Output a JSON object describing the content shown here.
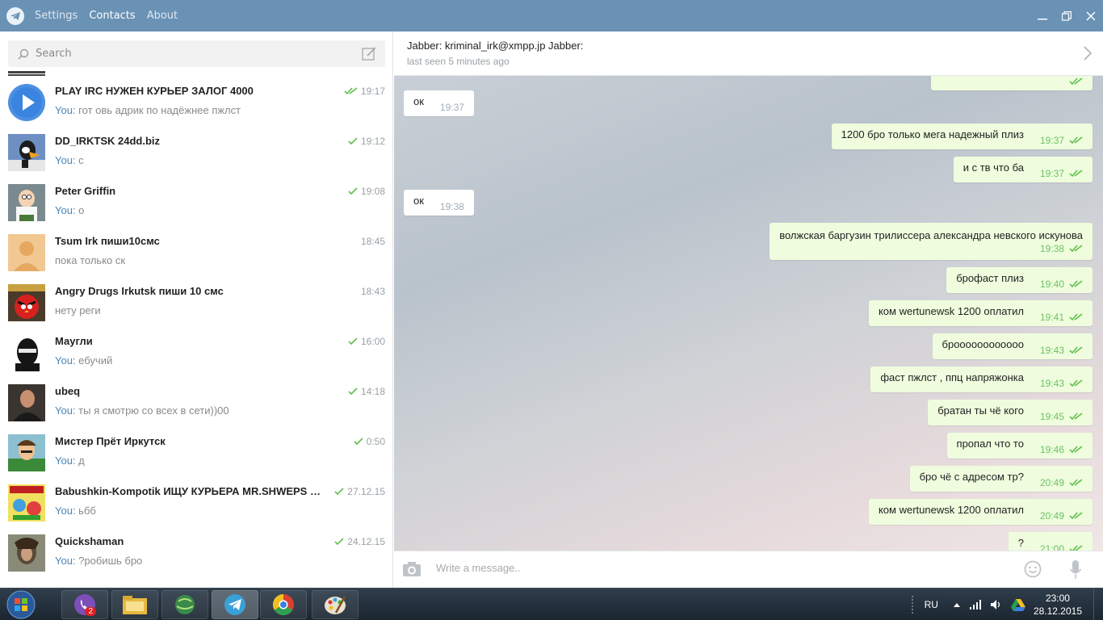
{
  "menu": {
    "settings": "Settings",
    "contacts": "Contacts",
    "about": "About"
  },
  "search": {
    "placeholder": "Search"
  },
  "chats": [
    {
      "name": "PLAY IRC НУЖЕН КУРЬЕР ЗАЛОГ 4000",
      "time": "19:17",
      "you": "You:",
      "preview": " гот овь адрик по надёжнее пжлст",
      "read": "double"
    },
    {
      "name": "DD_IRKTSK 24dd.biz",
      "time": "19:12",
      "you": "You:",
      "preview": " с",
      "read": "single"
    },
    {
      "name": "Peter Griffin",
      "time": "19:08",
      "you": "You:",
      "preview": " о",
      "read": "single"
    },
    {
      "name": "Tsum Irk пиши10смс",
      "time": "18:45",
      "you": "",
      "preview": "пока только ск",
      "read": "none"
    },
    {
      "name": "Angry Drugs Irkutsk пиши 10 смс",
      "time": "18:43",
      "you": "",
      "preview": "нету реги",
      "read": "none"
    },
    {
      "name": "Маугли",
      "time": "16:00",
      "you": "You:",
      "preview": " ебучий",
      "read": "single"
    },
    {
      "name": "ubeq",
      "time": "14:18",
      "you": "You:",
      "preview": " ты я смотрю со всех в сети))00",
      "read": "single"
    },
    {
      "name": "Мистер Прёт Иркутск",
      "time": "0:50",
      "you": "You:",
      "preview": " д",
      "read": "single"
    },
    {
      "name": "Babushkin-Kompotik ИЩУ КУРЬЕРА MR.SHWEPS @S...",
      "time": "27.12.15",
      "you": "You:",
      "preview": " ьбб",
      "read": "single"
    },
    {
      "name": "Quickshaman",
      "time": "24.12.15",
      "you": "You:",
      "preview": " ?робишь бро",
      "read": "single"
    }
  ],
  "header": {
    "title": "Jabber: kriminal_irk@xmpp.jp Jabber:",
    "status": "last seen 5 minutes ago"
  },
  "messages": [
    {
      "dir": "in",
      "text": "ок",
      "time": "19:37"
    },
    {
      "dir": "out",
      "text": "1200 бро только мега надежный плиз",
      "time": "19:37"
    },
    {
      "dir": "out",
      "text": "и с тв что ба",
      "time": "19:37"
    },
    {
      "dir": "in",
      "text": "ок",
      "time": "19:38"
    },
    {
      "dir": "out",
      "text": "волжская баргузин трилиссера александра невского искунова",
      "time": "19:38"
    },
    {
      "dir": "out",
      "text": "брофаст плиз",
      "time": "19:40"
    },
    {
      "dir": "out",
      "text": "ком wertunewsk 1200 оплатил",
      "time": "19:41"
    },
    {
      "dir": "out",
      "text": "броооооооооооо",
      "time": "19:43"
    },
    {
      "dir": "out",
      "text": "фаст пжлст , ппц напряжонка",
      "time": "19:43"
    },
    {
      "dir": "out",
      "text": "братан ты чё кого",
      "time": "19:45"
    },
    {
      "dir": "out",
      "text": "пропал что то",
      "time": "19:46"
    },
    {
      "dir": "out",
      "text": "бро чё с адресом тр?",
      "time": "20:49"
    },
    {
      "dir": "out",
      "text": "ком wertunewsk 1200 оплатил",
      "time": "20:49"
    },
    {
      "dir": "out",
      "text": "?",
      "time": "21:00"
    }
  ],
  "composer": {
    "placeholder": "Write a message.."
  },
  "taskbar": {
    "viber_badge": "2",
    "lang": "RU",
    "time": "23:00",
    "date": "28.12.2015"
  },
  "colors": {
    "titlebar": "#6a92b5",
    "accent": "#4a86b7",
    "outgoing": "#effdde",
    "check": "#5fbf4c"
  }
}
